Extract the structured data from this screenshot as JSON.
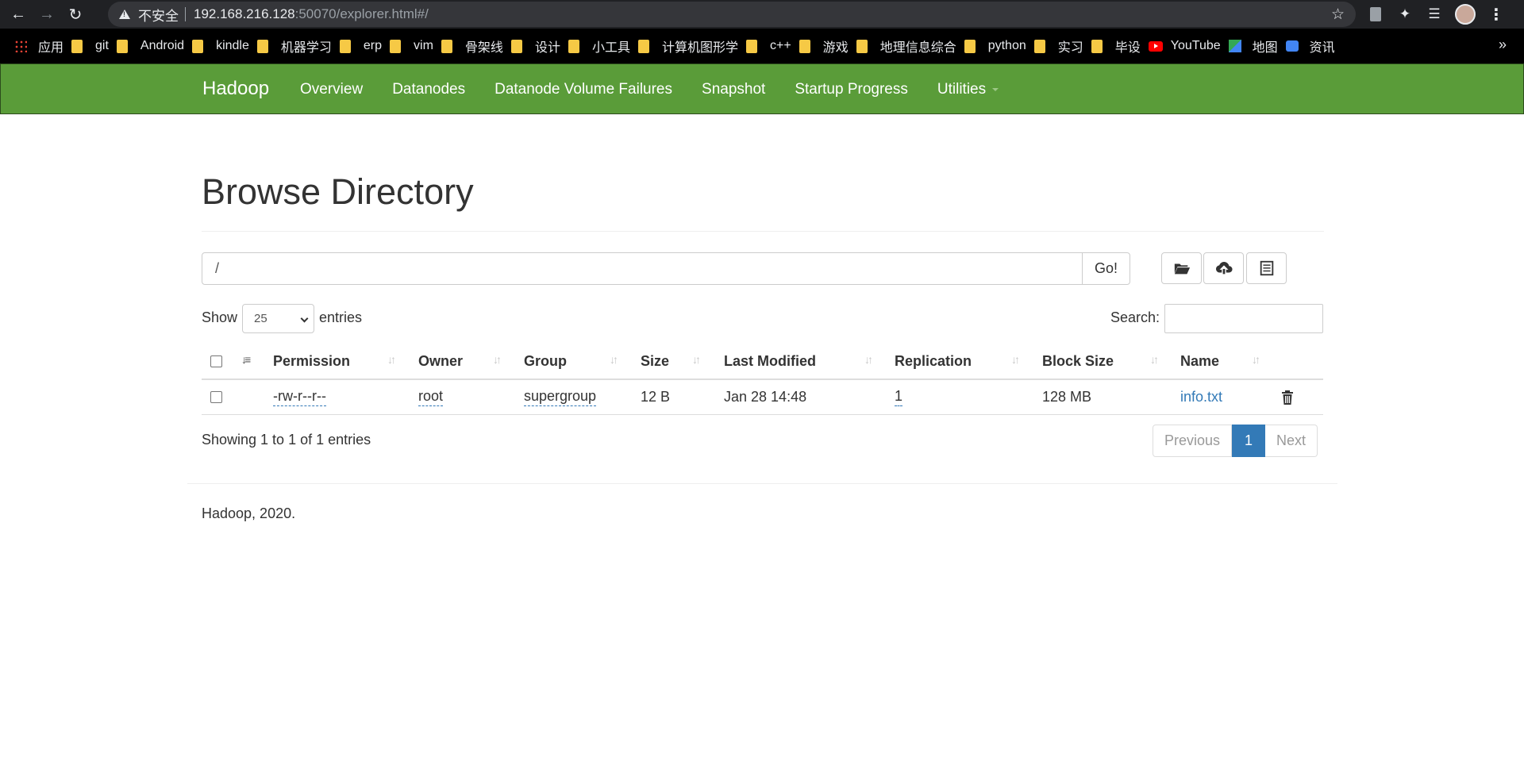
{
  "browser": {
    "insecure_label": "不安全",
    "url_host": "192.168.216.128",
    "url_path": ":50070/explorer.html#/"
  },
  "bookmarks": [
    {
      "label": "应用",
      "icon": "apps-grid-icon"
    },
    {
      "label": "git",
      "icon": "folder-icon"
    },
    {
      "label": "Android",
      "icon": "folder-icon"
    },
    {
      "label": "kindle",
      "icon": "folder-icon"
    },
    {
      "label": "机器学习",
      "icon": "folder-icon"
    },
    {
      "label": "erp",
      "icon": "folder-icon"
    },
    {
      "label": "vim",
      "icon": "folder-icon"
    },
    {
      "label": "骨架线",
      "icon": "folder-icon"
    },
    {
      "label": "设计",
      "icon": "folder-icon"
    },
    {
      "label": "小工具",
      "icon": "folder-icon"
    },
    {
      "label": "计算机图形学",
      "icon": "folder-icon"
    },
    {
      "label": "c++",
      "icon": "folder-icon"
    },
    {
      "label": "游戏",
      "icon": "folder-icon"
    },
    {
      "label": "地理信息综合",
      "icon": "folder-icon"
    },
    {
      "label": "python",
      "icon": "folder-icon"
    },
    {
      "label": "实习",
      "icon": "folder-icon"
    },
    {
      "label": "毕设",
      "icon": "folder-icon"
    },
    {
      "label": "YouTube",
      "icon": "youtube-icon"
    },
    {
      "label": "地图",
      "icon": "maps-icon"
    },
    {
      "label": "资讯",
      "icon": "news-icon"
    }
  ],
  "navbar": {
    "brand": "Hadoop",
    "links": [
      "Overview",
      "Datanodes",
      "Datanode Volume Failures",
      "Snapshot",
      "Startup Progress",
      "Utilities"
    ],
    "color": "#5a9c39"
  },
  "page": {
    "title": "Browse Directory",
    "path_value": "/",
    "go_label": "Go!",
    "show_label": "Show",
    "page_size": "25",
    "entries_label": "entries",
    "search_label": "Search:",
    "info": "Showing 1 to 1 of 1 entries",
    "footer": "Hadoop, 2020."
  },
  "table": {
    "columns": [
      "Permission",
      "Owner",
      "Group",
      "Size",
      "Last Modified",
      "Replication",
      "Block Size",
      "Name"
    ],
    "rows": [
      {
        "permission": "-rw-r--r--",
        "owner": "root",
        "group": "supergroup",
        "size": "12 B",
        "last_modified": "Jan 28 14:48",
        "replication": "1",
        "block_size": "128 MB",
        "name": "info.txt"
      }
    ]
  },
  "pagination": {
    "previous": "Previous",
    "current": "1",
    "next": "Next",
    "active_color": "#337ab7"
  }
}
